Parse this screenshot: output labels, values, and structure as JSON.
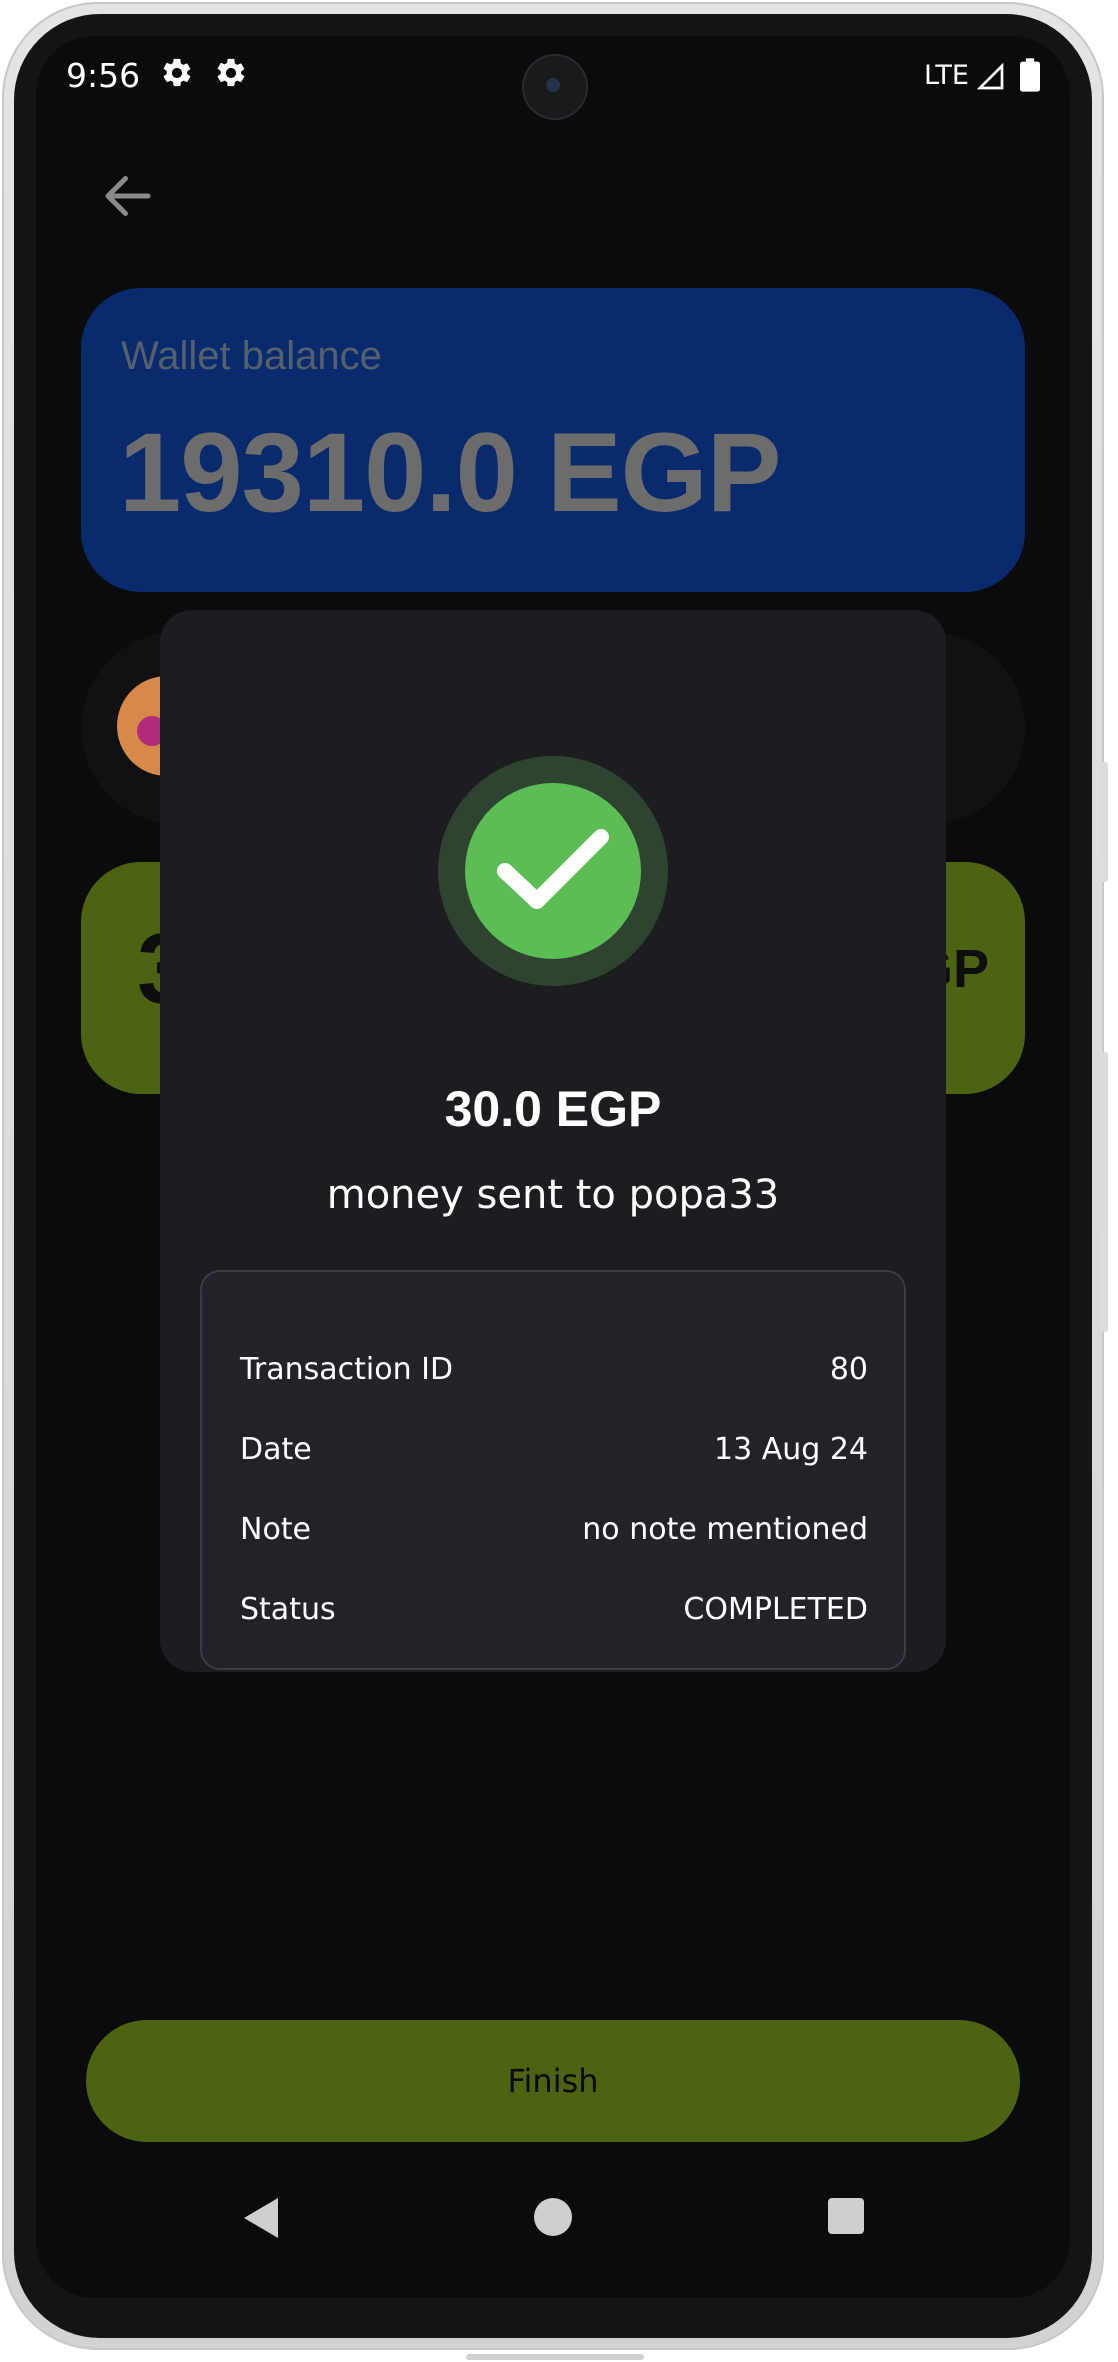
{
  "status_bar": {
    "time": "9:56",
    "network": "LTE",
    "icons": [
      "settings-gear-icon",
      "settings-gear-icon",
      "signal-icon",
      "battery-icon"
    ]
  },
  "header": {
    "back_icon": "arrow-left-icon"
  },
  "wallet": {
    "label": "Wallet balance",
    "amount": "19310.0 EGP"
  },
  "background_amount_card": {
    "left_text": "3",
    "right_text": "GP"
  },
  "dialog": {
    "icon": "check-icon",
    "amount": "30.0 EGP",
    "message": "money sent to popa33",
    "details": [
      {
        "key": "Transaction ID",
        "value": "80"
      },
      {
        "key": "Date",
        "value": "13 Aug 24"
      },
      {
        "key": "Note",
        "value": "no note mentioned"
      },
      {
        "key": "Status",
        "value": "COMPLETED"
      }
    ]
  },
  "finish_button": {
    "label": "Finish"
  },
  "colors": {
    "background": "#0b0b0d",
    "wallet_card": "#0a2a6e",
    "accent_green": "#4c6311",
    "dialog": "#1d1d21",
    "success_green": "#5cbd55"
  },
  "navbar": {
    "icons": [
      "nav-back-icon",
      "nav-home-icon",
      "nav-recents-icon"
    ]
  }
}
